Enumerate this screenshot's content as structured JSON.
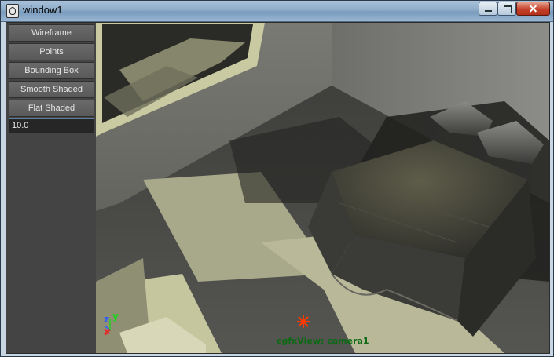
{
  "window": {
    "title": "window1",
    "icon": "maya-app-icon"
  },
  "sidebar": {
    "buttons": [
      {
        "label": "Wireframe"
      },
      {
        "label": "Points"
      },
      {
        "label": "Bounding Box"
      },
      {
        "label": "Smooth Shaded"
      },
      {
        "label": "Flat Shaded"
      }
    ],
    "value_field": "10.0"
  },
  "viewport": {
    "camera_label": "cgfxView: camera1",
    "axis": {
      "x": "x",
      "y": "y",
      "z": "z"
    }
  },
  "colors": {
    "panel_bg": "#444444",
    "button_bg": "#5e5e5e",
    "camera_label": "#0b6a13",
    "axis_x": "#e03030",
    "axis_y": "#20d020",
    "axis_z": "#2f5cff",
    "pivot_marker": "#ff3a00"
  }
}
